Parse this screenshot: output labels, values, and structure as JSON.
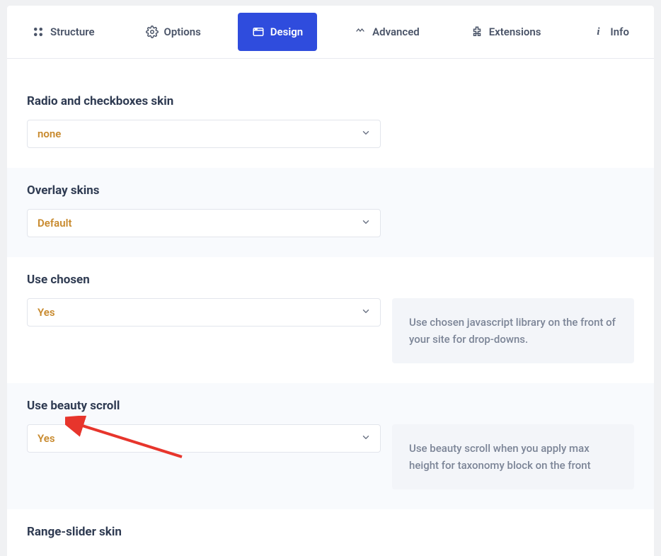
{
  "tabs": {
    "structure": "Structure",
    "options": "Options",
    "design": "Design",
    "advanced": "Advanced",
    "extensions": "Extensions",
    "info": "Info"
  },
  "sections": {
    "radio_skin": {
      "title": "Radio and checkboxes skin",
      "value": "none"
    },
    "overlay_skins": {
      "title": "Overlay skins",
      "value": "Default"
    },
    "use_chosen": {
      "title": "Use chosen",
      "value": "Yes",
      "hint": "Use chosen javascript library on the front of your site for drop-downs."
    },
    "beauty_scroll": {
      "title": "Use beauty scroll",
      "value": "Yes",
      "hint": "Use beauty scroll when you apply max height for taxonomy block on the front"
    },
    "range_slider": {
      "title": "Range-slider skin"
    }
  }
}
